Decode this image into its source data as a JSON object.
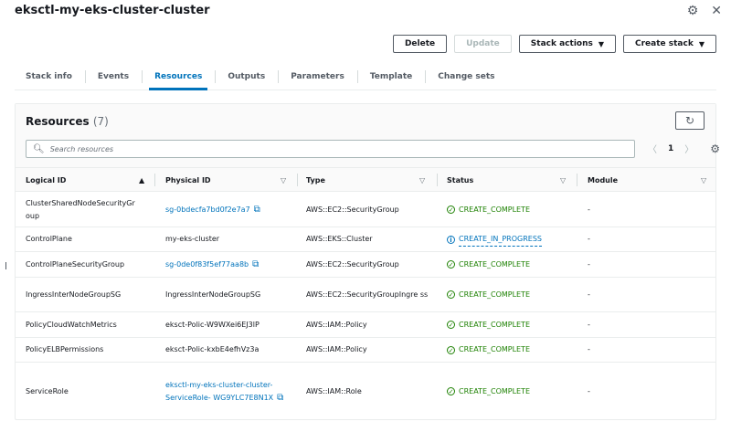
{
  "header": {
    "title": "eksctl-my-eks-cluster-cluster"
  },
  "actions": {
    "delete": "Delete",
    "update": "Update",
    "stack_actions": "Stack actions",
    "create_stack": "Create stack"
  },
  "tabs": [
    "Stack info",
    "Events",
    "Resources",
    "Outputs",
    "Parameters",
    "Template",
    "Change sets"
  ],
  "resources": {
    "title": "Resources",
    "count": "(7)",
    "search_placeholder": "Search resources",
    "page": "1"
  },
  "columns": {
    "logical_id": "Logical ID",
    "physical_id": "Physical ID",
    "type": "Type",
    "status": "Status",
    "module": "Module"
  },
  "rows": [
    {
      "logical": "ClusterSharedNodeSecurityGr oup",
      "physical": "sg-0bdecfa7bd0f2e7a7",
      "physical_link": true,
      "type": "AWS::EC2::SecurityGroup",
      "status": "CREATE_COMPLETE",
      "module": "-"
    },
    {
      "logical": "ControlPlane",
      "physical": "my-eks-cluster",
      "physical_link": false,
      "type": "AWS::EKS::Cluster",
      "status": "CREATE_IN_PROGRESS",
      "module": "-"
    },
    {
      "logical": "ControlPlaneSecurityGroup",
      "physical": "sg-0de0f83f5ef77aa8b",
      "physical_link": true,
      "type": "AWS::EC2::SecurityGroup",
      "status": "CREATE_COMPLETE",
      "module": "-"
    },
    {
      "logical": "IngressInterNodeGroupSG",
      "physical": "IngressInterNodeGroupSG",
      "physical_link": false,
      "type": "AWS::EC2::SecurityGroupIngre ss",
      "status": "CREATE_COMPLETE",
      "module": "-"
    },
    {
      "logical": "PolicyCloudWatchMetrics",
      "physical": "eksct-Polic-W9WXei6EJ3lP",
      "physical_link": false,
      "type": "AWS::IAM::Policy",
      "status": "CREATE_COMPLETE",
      "module": "-"
    },
    {
      "logical": "PolicyELBPermissions",
      "physical": "eksct-Polic-kxbE4efhVz3a",
      "physical_link": false,
      "type": "AWS::IAM::Policy",
      "status": "CREATE_COMPLETE",
      "module": "-"
    },
    {
      "logical": "ServiceRole",
      "physical": "eksctl-my-eks-cluster-cluster- ServiceRole- WG9YLC7E8N1X",
      "physical_link": true,
      "type": "AWS::IAM::Role",
      "status": "CREATE_COMPLETE",
      "module": "-"
    }
  ],
  "colors": {
    "link": "#0073bb",
    "success": "#1d8102",
    "border": "#eaeded"
  },
  "icons": {
    "settings": "gear-icon",
    "close": "close-icon",
    "refresh": "refresh-icon",
    "search": "search-icon",
    "external": "external-link-icon",
    "success": "check-circle-icon",
    "info": "info-circle-icon"
  }
}
